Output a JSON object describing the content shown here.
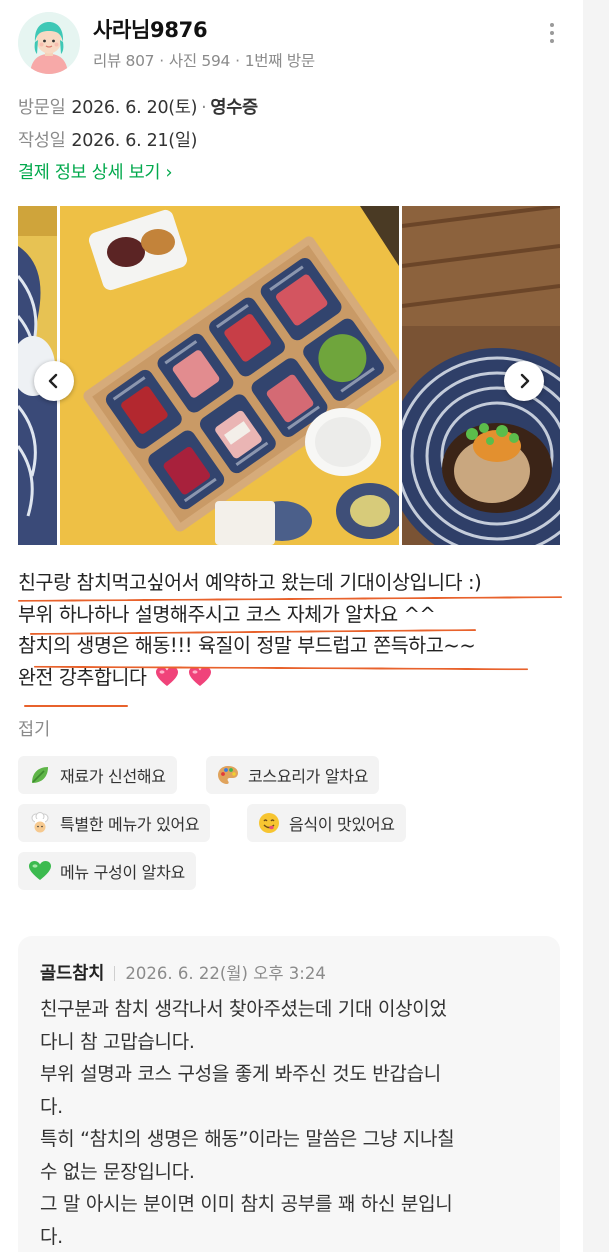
{
  "user": {
    "nickname": "사라님9876",
    "reviews": "리뷰 807",
    "photos": "사진 594",
    "visit_count": "1번째 방문",
    "dot": "·"
  },
  "visit": {
    "visit_label": "방문일",
    "visit_date": "2026. 6. 20(토)",
    "sep": "·",
    "receipt": "영수증",
    "write_label": "작성일",
    "write_date": "2026. 6. 21(일)",
    "payment_link": "결제 정보 상세 보기",
    "payment_chevron": "›"
  },
  "icons": {
    "more": "more-vertical-icon",
    "prev": "chevron-left-icon",
    "next": "chevron-right-icon",
    "heart": "heart-emoji-icon"
  },
  "review": {
    "lines": [
      "친구랑 참치먹고싶어서 예약하고 왔는데 기대이상입니다 :)",
      "부위 하나하나 설명해주시고 코스 자체가 알차요 ^^",
      "참치의 생명은 해동!!! 육질이 정말 부드럽고 쫀득하고~~",
      "완전 강추합니다"
    ],
    "collapse": "접기"
  },
  "tags": [
    {
      "label": "재료가 신선해요",
      "icon": "leaf-icon"
    },
    {
      "label": "코스요리가 알차요",
      "icon": "palette-icon"
    },
    {
      "label": "특별한 메뉴가 있어요",
      "icon": "chef-icon"
    },
    {
      "label": "음식이 맛있어요",
      "icon": "yum-face-icon"
    },
    {
      "label": "메뉴 구성이 알차요",
      "icon": "green-heart-icon"
    }
  ],
  "reply": {
    "owner": "골드참치",
    "date": "2026. 6. 22(월) 오후 3:24",
    "lines": [
      "친구분과 참치 생각나서 찾아주셨는데 기대 이상이었",
      "다니 참 고맙습니다.",
      "부위 설명과 코스 구성을 좋게 봐주신 것도 반갑습니",
      "다.",
      "특히 “참치의 생명은 해동”이라는 말씀은 그냥 지나칠",
      "수 없는 문장입니다.",
      "그 말 아시는 분이면 이미 참치 공부를 꽤 하신 분입니",
      "다."
    ]
  },
  "colors": {
    "accent_green": "#03a94d",
    "underline_orange": "#e8622c",
    "tag_bg": "#f3f3f3",
    "reply_bg": "#f7f7f7"
  }
}
